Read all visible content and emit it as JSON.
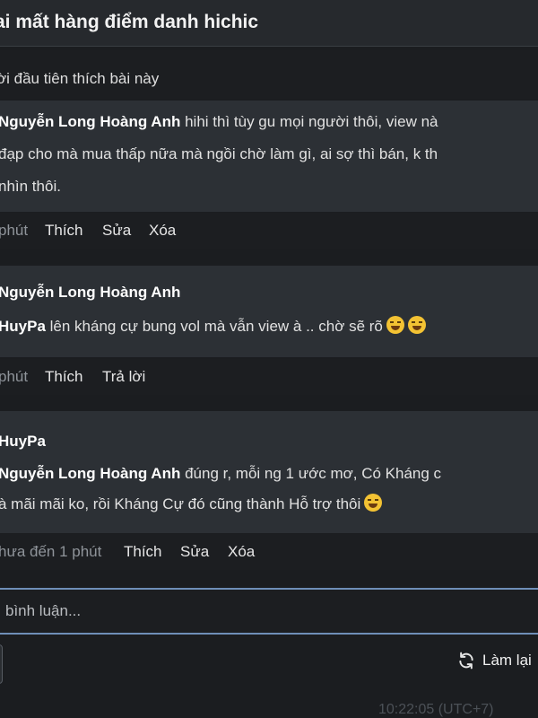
{
  "header": {
    "title": "ai mất hàng điểm danh hichic"
  },
  "likes_bar": {
    "text": "ời đầu tiên thích bài này"
  },
  "comments": [
    {
      "author": "Nguyễn Long Hoàng Anh",
      "line1_text": " hihi thì tùy gu mọi người thôi, view nà",
      "line2": "đạp cho mà mua thấp nữa mà ngồi chờ làm gì, ai sợ thì bán, k th",
      "line3": "nhìn thôi.",
      "time": "phút",
      "actions": [
        "Thích",
        "Sửa",
        "Xóa"
      ]
    },
    {
      "author": "Nguyễn Long Hoàng Anh",
      "mention": "HuyPa",
      "text": " lên kháng cự bung vol mà vẫn view à .. chờ sẽ rõ",
      "time": "phút",
      "actions": [
        "Thích",
        "Trả lời"
      ]
    },
    {
      "author": "HuyPa",
      "mention": "Nguyễn Long Hoàng Anh",
      "line1_text": " đúng r, mỗi ng 1 ước mơ, Có Kháng c",
      "line2": "à mãi mãi ko, rồi Kháng Cự đó cũng thành Hỗ trợ thôi",
      "time": "hưa đến 1 phút",
      "actions": [
        "Thích",
        "Sửa",
        "Xóa"
      ]
    }
  ],
  "comment_input": {
    "placeholder": "bình luận..."
  },
  "reload": {
    "label": "Làm lại"
  },
  "footer": {
    "timestamp": "10:22:05 (UTC+7)"
  },
  "colors": {
    "accent_border": "#6f8fb8",
    "background": "#1b1d20",
    "comment_bg": "#2c3035"
  }
}
